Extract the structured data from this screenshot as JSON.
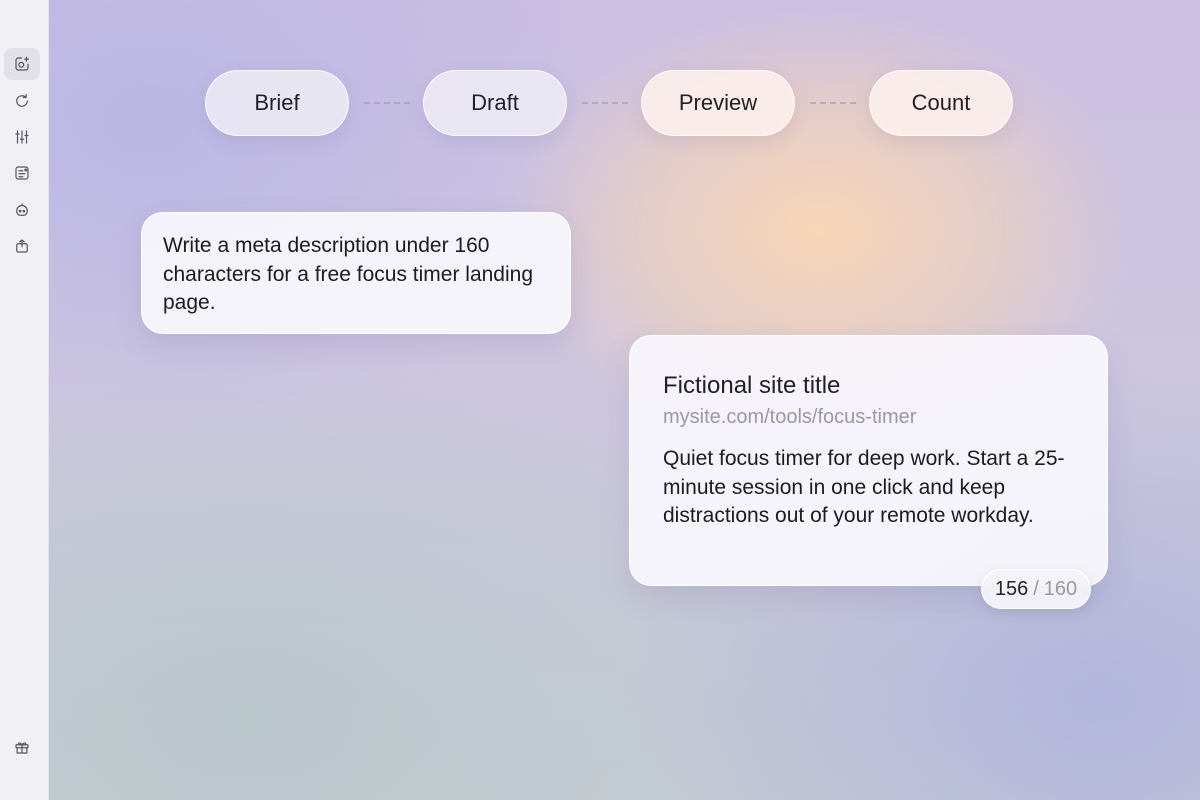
{
  "sidebar": {
    "items": [
      {
        "icon": "new-chat-icon"
      },
      {
        "icon": "refresh-icon"
      },
      {
        "icon": "adjust-icon"
      },
      {
        "icon": "notes-icon"
      },
      {
        "icon": "assistant-icon"
      },
      {
        "icon": "share-icon"
      }
    ],
    "bottom_icon": "gift-icon"
  },
  "steps": [
    "Brief",
    "Draft",
    "Preview",
    "Count"
  ],
  "prompt": {
    "text": "Write a meta description under 160 characters for a free focus timer landing page."
  },
  "preview": {
    "title": "Fictional site title",
    "url": "mysite.com/tools/focus-timer",
    "description": "Quiet focus timer for deep work. Start a 25-minute session in one click and keep distractions out of your remote workday."
  },
  "count": {
    "current": "156",
    "separator": "/",
    "max": "160"
  }
}
